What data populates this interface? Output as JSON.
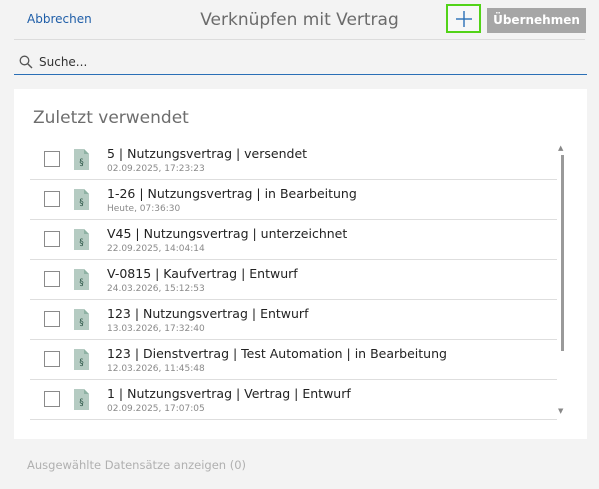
{
  "header": {
    "cancel_label": "Abbrechen",
    "title": "Verknüpfen mit Vertrag",
    "add_icon": "plus-icon",
    "apply_label": "Übernehmen",
    "apply_state": "disabled",
    "add_highlight_color": "#52d318"
  },
  "search": {
    "placeholder": "Suche...",
    "value": "",
    "icon": "search-icon"
  },
  "recent": {
    "title": "Zuletzt verwendet",
    "items": [
      {
        "label": "5 | Nutzungsvertrag | versendet",
        "timestamp": "02.09.2025, 17:23:23",
        "checked": false
      },
      {
        "label": "1-26 | Nutzungsvertrag | in Bearbeitung",
        "timestamp": "Heute, 07:36:30",
        "checked": false
      },
      {
        "label": "V45 | Nutzungsvertrag | unterzeichnet",
        "timestamp": "22.09.2025, 14:04:14",
        "checked": false
      },
      {
        "label": "V-0815 | Kaufvertrag | Entwurf",
        "timestamp": "24.03.2026, 15:12:53",
        "checked": false
      },
      {
        "label": "123 | Nutzungsvertrag | Entwurf",
        "timestamp": "13.03.2026, 17:32:40",
        "checked": false
      },
      {
        "label": "123 | Dienstvertrag | Test Automation | in Bearbeitung",
        "timestamp": "12.03.2026, 11:45:48",
        "checked": false
      },
      {
        "label": "1 | Nutzungsvertrag | Vertrag | Entwurf",
        "timestamp": "02.09.2025, 17:07:05",
        "checked": false
      }
    ]
  },
  "footer": {
    "show_selected_label": "Ausgewählte Datensätze anzeigen (0)"
  }
}
